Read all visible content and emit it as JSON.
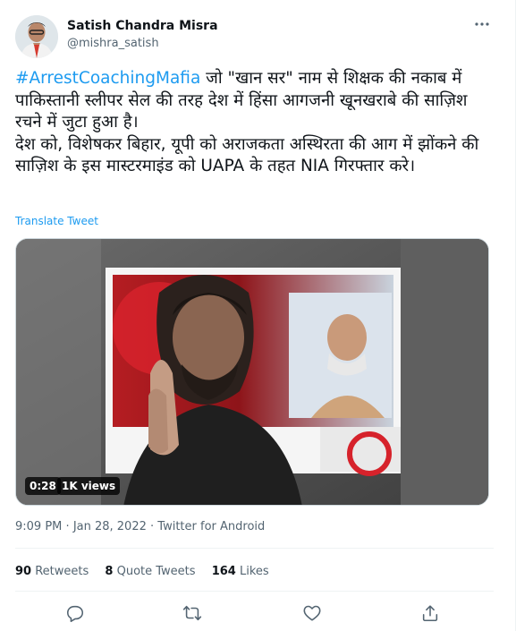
{
  "author": {
    "name": "Satish Chandra Misra",
    "handle": "@mishra_satish"
  },
  "tweet": {
    "hashtag": "#ArrestCoachingMafia",
    "text_after_hashtag": " जो \"खान सर\" नाम से शिक्षक की नकाब में पाकिस्तानी स्लीपर सेल की तरह देश में हिंसा आगजनी खूनखराबे की साज़िश रचने में जुटा हुआ है।\nदेश को, विशेषकर बिहार, यूपी को अराजकता अस्थिरता की आग में झोंकने की साज़िश के इस मास्टरमाइंड को UAPA के तहत NIA गिरफ्तार करे।",
    "translate_label": "Translate Tweet"
  },
  "media": {
    "duration": "0:28",
    "views": "1K views"
  },
  "meta": {
    "time": "9:09 PM",
    "separator": "·",
    "date": "Jan 28, 2022",
    "source": "Twitter for Android"
  },
  "stats": {
    "retweets_count": "90",
    "retweets_label": "Retweets",
    "quotes_count": "8",
    "quotes_label": "Quote Tweets",
    "likes_count": "164",
    "likes_label": "Likes"
  },
  "icons": {
    "more": "more-options-icon",
    "reply": "reply-icon",
    "retweet": "retweet-icon",
    "like": "heart-icon",
    "share": "share-icon"
  },
  "colors": {
    "accent": "#1d9bf0",
    "text": "#0f1419",
    "secondary": "#536471",
    "border": "#eff3f4"
  }
}
